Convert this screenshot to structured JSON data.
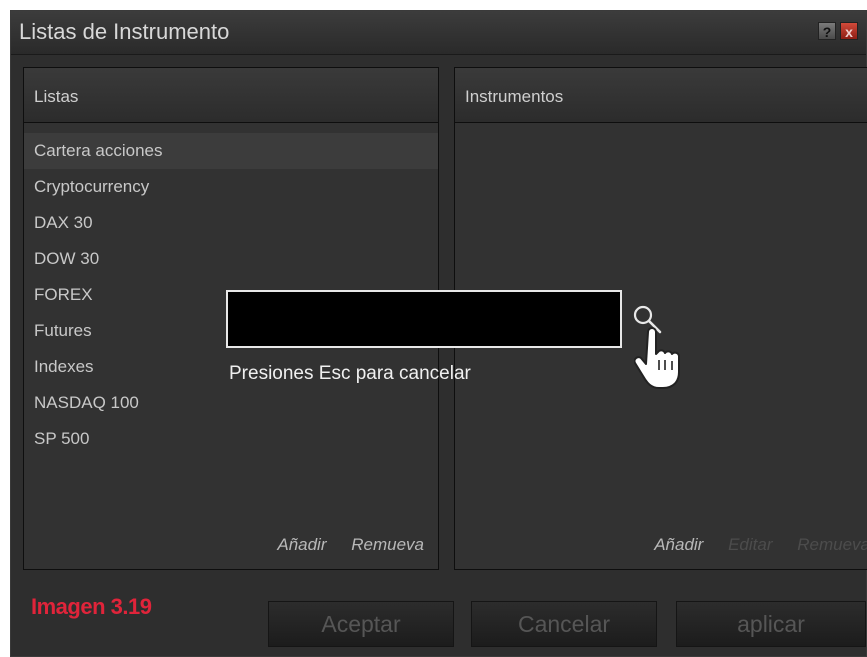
{
  "dialog": {
    "title": "Listas de Instrumento",
    "help_label": "?",
    "close_label": "x"
  },
  "left_panel": {
    "header": "Listas",
    "items": [
      {
        "label": "Cartera acciones",
        "selected": true
      },
      {
        "label": "Cryptocurrency"
      },
      {
        "label": "DAX 30"
      },
      {
        "label": "DOW 30"
      },
      {
        "label": "FOREX"
      },
      {
        "label": "Futures"
      },
      {
        "label": "Indexes"
      },
      {
        "label": "NASDAQ 100"
      },
      {
        "label": "SP 500"
      }
    ],
    "add_label": "Añadir",
    "remove_label": "Remueva"
  },
  "right_panel": {
    "header": "Instrumentos",
    "add_label": "Añadir",
    "edit_label": "Editar",
    "remove_label": "Remueva"
  },
  "search": {
    "value": "",
    "hint": "Presiones Esc para cancelar"
  },
  "footer": {
    "badge": "Imagen 3.19",
    "accept_label": "Aceptar",
    "cancel_label": "Cancelar",
    "apply_label": "aplicar"
  },
  "colors": {
    "badge": "#e0243a",
    "dialog_bg": "#2e2e2e",
    "panel_bg": "#323232",
    "search_bg": "#000000"
  }
}
